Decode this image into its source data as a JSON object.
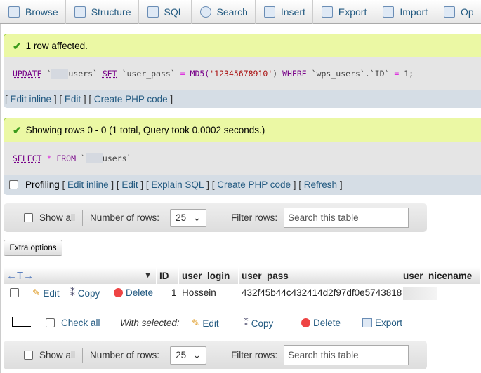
{
  "tabs": [
    {
      "label": "Browse",
      "icon": "browse-icon"
    },
    {
      "label": "Structure",
      "icon": "structure-icon"
    },
    {
      "label": "SQL",
      "icon": "sql-icon"
    },
    {
      "label": "Search",
      "icon": "search-icon"
    },
    {
      "label": "Insert",
      "icon": "insert-icon"
    },
    {
      "label": "Export",
      "icon": "export-icon"
    },
    {
      "label": "Import",
      "icon": "import-icon"
    },
    {
      "label": "Op",
      "icon": "wrench-icon"
    }
  ],
  "msg1": {
    "text": "1 row affected.",
    "sql": {
      "k1": "UPDATE",
      "t1": " `",
      "t2": "users` ",
      "k2": "SET",
      "t3": " `user_pass` ",
      "eq": "=",
      "fn": " MD5(",
      "str": "'12345678910'",
      "t4": ") ",
      "k3": "WHERE",
      "t5": " `wps_users`.`ID` ",
      "eq2": "=",
      "t6": " 1;"
    },
    "links": [
      "Edit inline",
      "Edit",
      "Create PHP code"
    ]
  },
  "msg2": {
    "text": "Showing rows 0 - 0 (1 total, Query took 0.0002 seconds.)",
    "sql": {
      "k1": "SELECT",
      "star": " *",
      "k2": " FROM",
      "t1": " `",
      "t2": "users`"
    },
    "profiling": "Profiling",
    "links": [
      "Edit inline",
      "Edit",
      "Explain SQL",
      "Create PHP code",
      "Refresh"
    ]
  },
  "nav": {
    "show_all": "Show all",
    "rows_label": "Number of rows:",
    "rows_value": "25",
    "filter_label": "Filter rows:",
    "filter_placeholder": "Search this table"
  },
  "extra_options": "Extra options",
  "table": {
    "columns": [
      "ID",
      "user_login",
      "user_pass",
      "user_nicename"
    ],
    "rows": [
      {
        "edit": "Edit",
        "copy": "Copy",
        "delete": "Delete",
        "ID": "1",
        "user_login": "Hossein",
        "user_pass": "432f45b44c432414d2f97df0e5743818"
      }
    ]
  },
  "bulk": {
    "check_all": "Check all",
    "with_selected": "With selected:",
    "edit": "Edit",
    "copy": "Copy",
    "delete": "Delete",
    "export": "Export"
  }
}
